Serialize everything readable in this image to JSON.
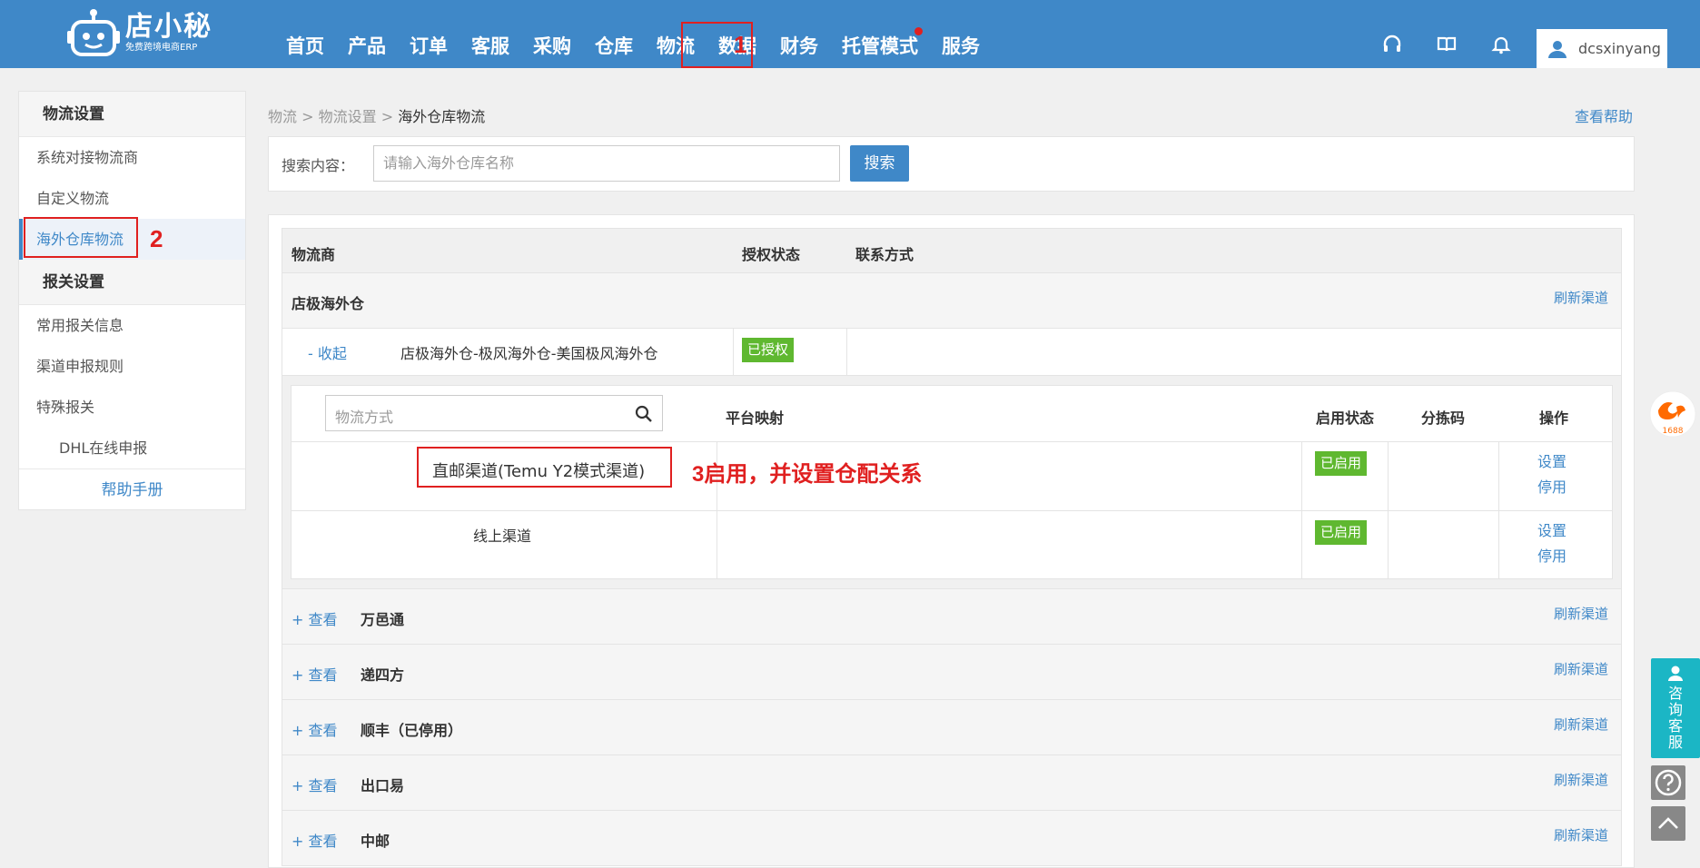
{
  "app": {
    "logo_name": "店小秘",
    "logo_sub": "免费跨境电商ERP"
  },
  "nav": [
    {
      "label": "首页"
    },
    {
      "label": "产品"
    },
    {
      "label": "订单"
    },
    {
      "label": "客服"
    },
    {
      "label": "采购"
    },
    {
      "label": "仓库"
    },
    {
      "label": "物流"
    },
    {
      "label": "数据"
    },
    {
      "label": "财务"
    },
    {
      "label": "托管模式"
    },
    {
      "label": "服务"
    }
  ],
  "user": {
    "name": "dcsxinyang"
  },
  "annotations": {
    "n1": "1",
    "n2": "2",
    "n3": "3启用，并设置仓配关系"
  },
  "sidebar": {
    "section1": "物流设置",
    "items1": [
      "系统对接物流商",
      "自定义物流",
      "海外仓库物流"
    ],
    "section2": "报关设置",
    "items2": [
      "常用报关信息",
      "渠道申报规则",
      "特殊报关",
      "DHL在线申报"
    ],
    "help": "帮助手册"
  },
  "breadcrumb": {
    "a": "物流",
    "sep": ">",
    "b": "物流设置",
    "c": "海外仓库物流"
  },
  "help_link": "查看帮助",
  "search": {
    "label": "搜索内容：",
    "placeholder": "请输入海外仓库名称",
    "button": "搜索"
  },
  "table": {
    "headers": {
      "provider": "物流商",
      "auth": "授权状态",
      "contact": "联系方式"
    },
    "expanded_group": {
      "name": "店极海外仓",
      "refresh": "刷新渠道",
      "toggle": "- 收起",
      "warehouse": "店极海外仓-极风海外仓-美国极风海外仓",
      "auth_status": "已授权"
    },
    "inner": {
      "method_placeholder": "物流方式",
      "col_mapping": "平台映射",
      "col_status": "启用状态",
      "col_code": "分拣码",
      "col_ops": "操作",
      "rows": [
        {
          "name": "直邮渠道(Temu Y2模式渠道)",
          "status": "已启用",
          "op1": "设置",
          "op2": "停用"
        },
        {
          "name": "线上渠道",
          "status": "已启用",
          "op1": "设置",
          "op2": "停用"
        }
      ]
    },
    "groups": [
      {
        "toggle": "+ 查看",
        "name": "万邑通",
        "refresh": "刷新渠道"
      },
      {
        "toggle": "+ 查看",
        "name": "递四方",
        "refresh": "刷新渠道"
      },
      {
        "toggle": "+ 查看",
        "name": "顺丰（已停用）",
        "refresh": "刷新渠道"
      },
      {
        "toggle": "+ 查看",
        "name": "出口易",
        "refresh": "刷新渠道"
      },
      {
        "toggle": "+ 查看",
        "name": "中邮",
        "refresh": "刷新渠道"
      }
    ]
  },
  "float": {
    "service": [
      "咨",
      "询",
      "客",
      "服"
    ],
    "badge_1688": "1688"
  },
  "colors": {
    "primary": "#3f88c8",
    "highlight": "#e02020",
    "enabled": "#5fb830",
    "service": "#1bb6c5"
  }
}
